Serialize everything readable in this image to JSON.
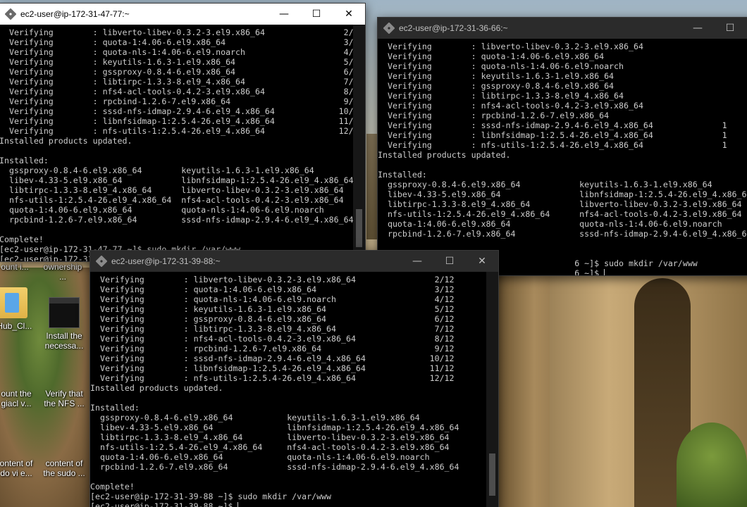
{
  "desktop": {
    "icons": [
      {
        "label": "ount i..."
      },
      {
        "label": "ownership ..."
      },
      {
        "label": "gHub_Cl..."
      },
      {
        "label": "Install the necessa..."
      },
      {
        "label": "ount the giacl v..."
      },
      {
        "label": "Verify that the NFS ..."
      },
      {
        "label": "ontent of do vi e..."
      },
      {
        "label": "content of the sudo ..."
      }
    ]
  },
  "windows": [
    {
      "title": "ec2-user@ip-172-31-47-77:~",
      "state": "active",
      "lines": [
        "  Verifying        : libverto-libev-0.3.2-3.el9.x86_64                2/12",
        "  Verifying        : quota-1:4.06-6.el9.x86_64                        3/12",
        "  Verifying        : quota-nls-1:4.06-6.el9.noarch                    4/12",
        "  Verifying        : keyutils-1.6.3-1.el9.x86_64                      5/12",
        "  Verifying        : gssproxy-0.8.4-6.el9.x86_64                      6/12",
        "  Verifying        : libtirpc-1.3.3-8.el9_4.x86_64                    7/12",
        "  Verifying        : nfs4-acl-tools-0.4.2-3.el9.x86_64                8/12",
        "  Verifying        : rpcbind-1.2.6-7.el9.x86_64                       9/12",
        "  Verifying        : sssd-nfs-idmap-2.9.4-6.el9_4.x86_64             10/12",
        "  Verifying        : libnfsidmap-1:2.5.4-26.el9_4.x86_64             11/12",
        "  Verifying        : nfs-utils-1:2.5.4-26.el9_4.x86_64               12/12",
        "Installed products updated.",
        "",
        "Installed:",
        "  gssproxy-0.8.4-6.el9.x86_64        keyutils-1.6.3-1.el9.x86_64",
        "  libev-4.33-5.el9.x86_64            libnfsidmap-1:2.5.4-26.el9_4.x86_64",
        "  libtirpc-1.3.3-8.el9_4.x86_64      libverto-libev-0.3.2-3.el9.x86_64",
        "  nfs-utils-1:2.5.4-26.el9_4.x86_64  nfs4-acl-tools-0.4.2-3.el9.x86_64",
        "  quota-1:4.06-6.el9.x86_64          quota-nls-1:4.06-6.el9.noarch",
        "  rpcbind-1.2.6-7.el9.x86_64         sssd-nfs-idmap-2.9.4-6.el9_4.x86_64",
        "",
        "Complete!",
        "[ec2-user@ip-172-31-47-77 ~]$ sudo mkdir /var/www",
        "[ec2-user@ip-172-31-47-77 ~]$ "
      ]
    },
    {
      "title": "ec2-user@ip-172-31-36-66:~",
      "state": "inactive",
      "lines": [
        "  Verifying        : libverto-libev-0.3.2-3.el9.x86_64",
        "  Verifying        : quota-1:4.06-6.el9.x86_64",
        "  Verifying        : quota-nls-1:4.06-6.el9.noarch",
        "  Verifying        : keyutils-1.6.3-1.el9.x86_64",
        "  Verifying        : gssproxy-0.8.4-6.el9.x86_64",
        "  Verifying        : libtirpc-1.3.3-8.el9_4.x86_64",
        "  Verifying        : nfs4-acl-tools-0.4.2-3.el9.x86_64",
        "  Verifying        : rpcbind-1.2.6-7.el9.x86_64",
        "  Verifying        : sssd-nfs-idmap-2.9.4-6.el9_4.x86_64              1",
        "  Verifying        : libnfsidmap-1:2.5.4-26.el9_4.x86_64              1",
        "  Verifying        : nfs-utils-1:2.5.4-26.el9_4.x86_64                1",
        "Installed products updated.",
        "",
        "Installed:",
        "  gssproxy-0.8.4-6.el9.x86_64            keyutils-1.6.3-1.el9.x86_64",
        "  libev-4.33-5.el9.x86_64                libnfsidmap-1:2.5.4-26.el9_4.x86_64",
        "  libtirpc-1.3.3-8.el9_4.x86_64          libverto-libev-0.3.2-3.el9.x86_64",
        "  nfs-utils-1:2.5.4-26.el9_4.x86_64      nfs4-acl-tools-0.4.2-3.el9.x86_64",
        "  quota-1:4.06-6.el9.x86_64              quota-nls-1:4.06-6.el9.noarch",
        "  rpcbind-1.2.6-7.el9.x86_64             sssd-nfs-idmap-2.9.4-6.el9_4.x86_64",
        "",
        "Complete!",
        "                                        6 ~]$ sudo mkdir /var/www",
        "                                        6 ~]$ "
      ]
    },
    {
      "title": "ec2-user@ip-172-31-39-88:~",
      "state": "inactive",
      "lines": [
        "  Verifying        : libverto-libev-0.3.2-3.el9.x86_64                2/12",
        "  Verifying        : quota-1:4.06-6.el9.x86_64                        3/12",
        "  Verifying        : quota-nls-1:4.06-6.el9.noarch                    4/12",
        "  Verifying        : keyutils-1.6.3-1.el9.x86_64                      5/12",
        "  Verifying        : gssproxy-0.8.4-6.el9.x86_64                      6/12",
        "  Verifying        : libtirpc-1.3.3-8.el9_4.x86_64                    7/12",
        "  Verifying        : nfs4-acl-tools-0.4.2-3.el9.x86_64                8/12",
        "  Verifying        : rpcbind-1.2.6-7.el9.x86_64                       9/12",
        "  Verifying        : sssd-nfs-idmap-2.9.4-6.el9_4.x86_64             10/12",
        "  Verifying        : libnfsidmap-1:2.5.4-26.el9_4.x86_64             11/12",
        "  Verifying        : nfs-utils-1:2.5.4-26.el9_4.x86_64               12/12",
        "Installed products updated.",
        "",
        "Installed:",
        "  gssproxy-0.8.4-6.el9.x86_64           keyutils-1.6.3-1.el9.x86_64",
        "  libev-4.33-5.el9.x86_64               libnfsidmap-1:2.5.4-26.el9_4.x86_64",
        "  libtirpc-1.3.3-8.el9_4.x86_64         libverto-libev-0.3.2-3.el9.x86_64",
        "  nfs-utils-1:2.5.4-26.el9_4.x86_64     nfs4-acl-tools-0.4.2-3.el9.x86_64",
        "  quota-1:4.06-6.el9.x86_64             quota-nls-1:4.06-6.el9.noarch",
        "  rpcbind-1.2.6-7.el9.x86_64            sssd-nfs-idmap-2.9.4-6.el9_4.x86_64",
        "",
        "Complete!",
        "[ec2-user@ip-172-31-39-88 ~]$ sudo mkdir /var/www",
        "[ec2-user@ip-172-31-39-88 ~]$ "
      ]
    }
  ],
  "controls": {
    "minimize": "—",
    "maximize": "☐",
    "close": "✕"
  }
}
